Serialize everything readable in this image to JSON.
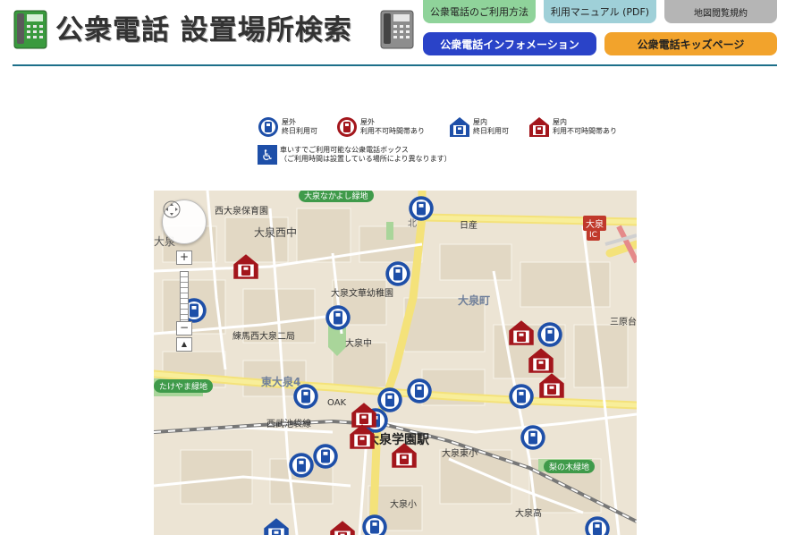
{
  "header": {
    "title": "公衆電話 設置場所検索",
    "buttons": {
      "usage": "公衆電話のご利用方法",
      "manual": "利用マニュアル (PDF)",
      "terms": "地図閲覧規約",
      "info": "公衆電話インフォメーション",
      "kids": "公衆電話キッズページ"
    },
    "icons": [
      "green-payphone-icon",
      "gray-payphone-icon"
    ]
  },
  "legend": {
    "outdoor_24h": [
      "屋外",
      "終日利用可"
    ],
    "outdoor_limited": [
      "屋外",
      "利用不可時間帯あり"
    ],
    "indoor_24h": [
      "屋内",
      "終日利用可"
    ],
    "indoor_limited": [
      "屋内",
      "利用不可時間帯あり"
    ],
    "wheelchair": [
      "車いすでご利用可能な公衆電話ボックス",
      "（ご利用時間は設置している場所により異なります）"
    ],
    "colors": {
      "blue": "#1e4fa8",
      "red": "#a3161c"
    }
  },
  "map": {
    "labels": {
      "oizumi_nakayoshi": "大泉なかよし緑地",
      "nishi_oizumi_nursery": "西大泉保育園",
      "oizumi_nishi_jhs": "大泉西中",
      "oizumi_gakuen_top": "大泉",
      "kita_toukatsu": "北",
      "nisseki": "日産",
      "oizumi_ic": "大泉",
      "ic": "IC",
      "oizumi_bunka": "大泉文華幼稚園",
      "oizumi_town": "大泉町",
      "sanpara": "三原台",
      "nerima_nishi": "練馬西大泉二局",
      "oizumi_chu": "大泉中",
      "higashi_oizumi": "東大泉4",
      "takeyama": "たけやま緑地",
      "oak": "OAK",
      "seibu_line": "西武池袋線",
      "station": "大泉学園駅",
      "oizumi_higashi_es": "大泉東小",
      "nashi": "梨の木緑地",
      "oizumi_es": "大泉小",
      "oizumi_hs": "大泉高"
    }
  }
}
